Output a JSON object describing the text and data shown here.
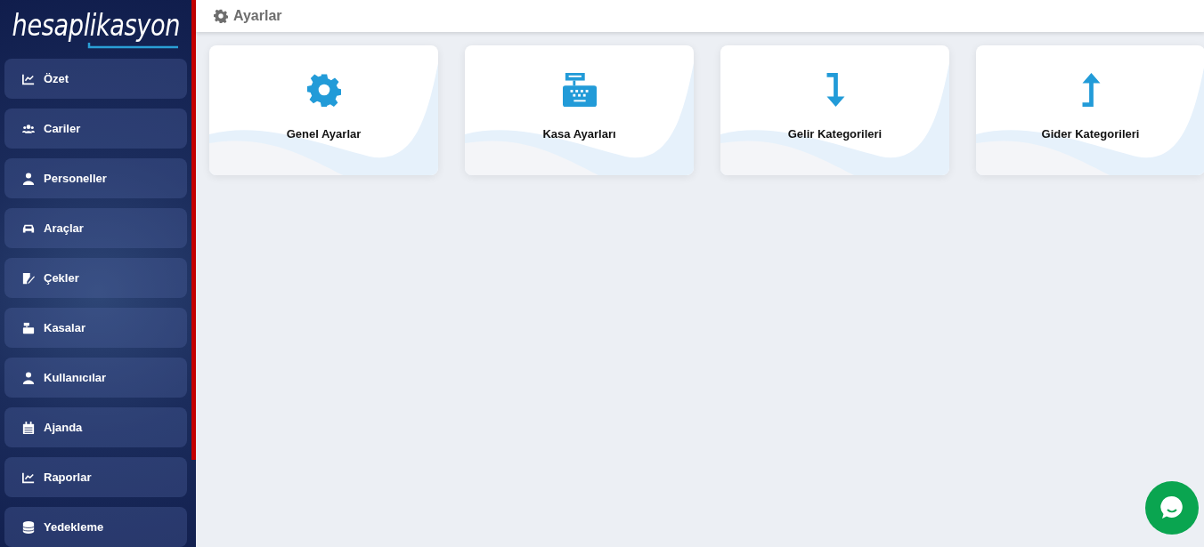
{
  "logo": "hesaplikasyon",
  "sidebar": {
    "items": [
      {
        "label": "Özet",
        "kind": "chart"
      },
      {
        "label": "Cariler",
        "kind": "users"
      },
      {
        "label": "Personeller",
        "kind": "user"
      },
      {
        "label": "Araçlar",
        "kind": "car"
      },
      {
        "label": "Çekler",
        "kind": "edit"
      },
      {
        "label": "Kasalar",
        "kind": "register"
      },
      {
        "label": "Kullanıcılar",
        "kind": "user"
      },
      {
        "label": "Ajanda",
        "kind": "calendar"
      },
      {
        "label": "Raporlar",
        "kind": "chart"
      },
      {
        "label": "Yedekleme",
        "kind": "database"
      }
    ]
  },
  "header": {
    "title": "Ayarlar"
  },
  "cards": [
    {
      "label": "Genel Ayarlar",
      "kind": "gear"
    },
    {
      "label": "Kasa Ayarları",
      "kind": "register"
    },
    {
      "label": "Gelir Kategorileri",
      "kind": "arrow-down"
    },
    {
      "label": "Gider Kategorileri",
      "kind": "arrow-up"
    }
  ]
}
